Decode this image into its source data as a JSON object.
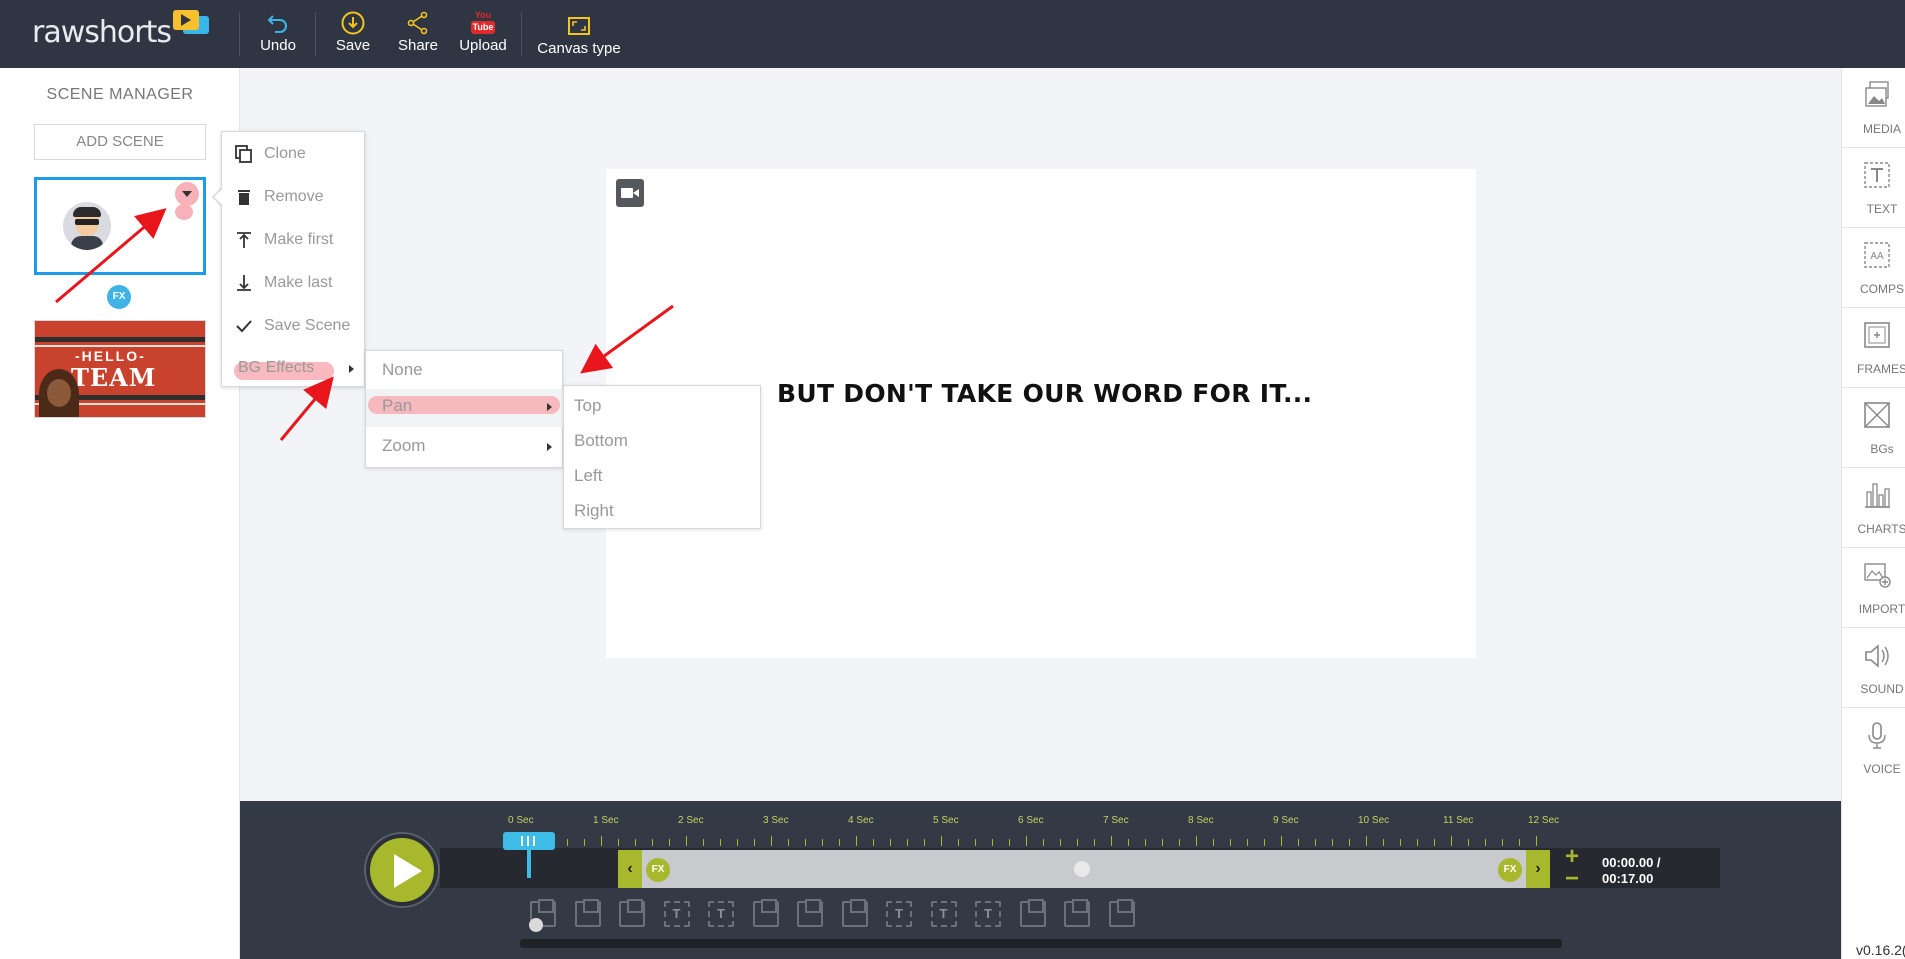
{
  "app": {
    "brand": "rawshorts",
    "version": "v0.16.2("
  },
  "toolbar": {
    "undo_label": "Undo",
    "save_label": "Save",
    "share_label": "Share",
    "upload_label": "Upload",
    "upload_icon_text_top": "You",
    "upload_icon_text_bottom": "Tube",
    "canvas_type_label": "Canvas type"
  },
  "scene_manager": {
    "title": "SCENE MANAGER",
    "add_scene_label": "ADD SCENE",
    "fx_badge": "FX",
    "scene2_hello": "-HELLO-",
    "scene2_team": "TEAM"
  },
  "context_menu": {
    "items": [
      {
        "label": "Clone",
        "icon": "clone-icon"
      },
      {
        "label": "Remove",
        "icon": "trash-icon"
      },
      {
        "label": "Make first",
        "icon": "make-first-icon"
      },
      {
        "label": "Make last",
        "icon": "make-last-icon"
      },
      {
        "label": "Save Scene",
        "icon": "check-icon"
      },
      {
        "label": "BG Effects",
        "icon": ""
      }
    ]
  },
  "bg_effects_menu": {
    "items": [
      "None",
      "Pan",
      "Zoom"
    ]
  },
  "pan_menu": {
    "items": [
      "Top",
      "Bottom",
      "Left",
      "Right"
    ]
  },
  "canvas": {
    "text": "BUT DON'T TAKE OUR WORD FOR IT..."
  },
  "right_panel": {
    "items": [
      {
        "label": "MEDIA",
        "icon": "media-icon"
      },
      {
        "label": "TEXT",
        "icon": "text-icon"
      },
      {
        "label": "COMPS",
        "icon": "comps-icon"
      },
      {
        "label": "FRAMES",
        "icon": "frames-icon"
      },
      {
        "label": "BGs",
        "icon": "bgs-icon"
      },
      {
        "label": "CHARTS",
        "icon": "charts-icon"
      },
      {
        "label": "IMPORT",
        "icon": "import-icon"
      },
      {
        "label": "SOUND",
        "icon": "sound-icon"
      },
      {
        "label": "VOICE",
        "icon": "voice-icon"
      }
    ]
  },
  "timeline": {
    "ruler_labels": [
      "0 Sec",
      "1 Sec",
      "2 Sec",
      "3 Sec",
      "4 Sec",
      "5 Sec",
      "6 Sec",
      "7 Sec",
      "8 Sec",
      "9 Sec",
      "10 Sec",
      "11 Sec",
      "12 Sec"
    ],
    "fx_label": "FX",
    "current_time": "00:00.00 /",
    "total_time": "00:17.00",
    "layer_icons": [
      "img",
      "img",
      "img",
      "txt",
      "txt",
      "img",
      "img",
      "img",
      "txt",
      "txt",
      "txt",
      "img",
      "img",
      "img"
    ],
    "text_layer_glyph": "T"
  },
  "colors": {
    "accent_green": "#a7b82d",
    "accent_blue": "#1e9be9",
    "topbar_bg": "#2f3542",
    "annotation_red": "#e8151b"
  }
}
